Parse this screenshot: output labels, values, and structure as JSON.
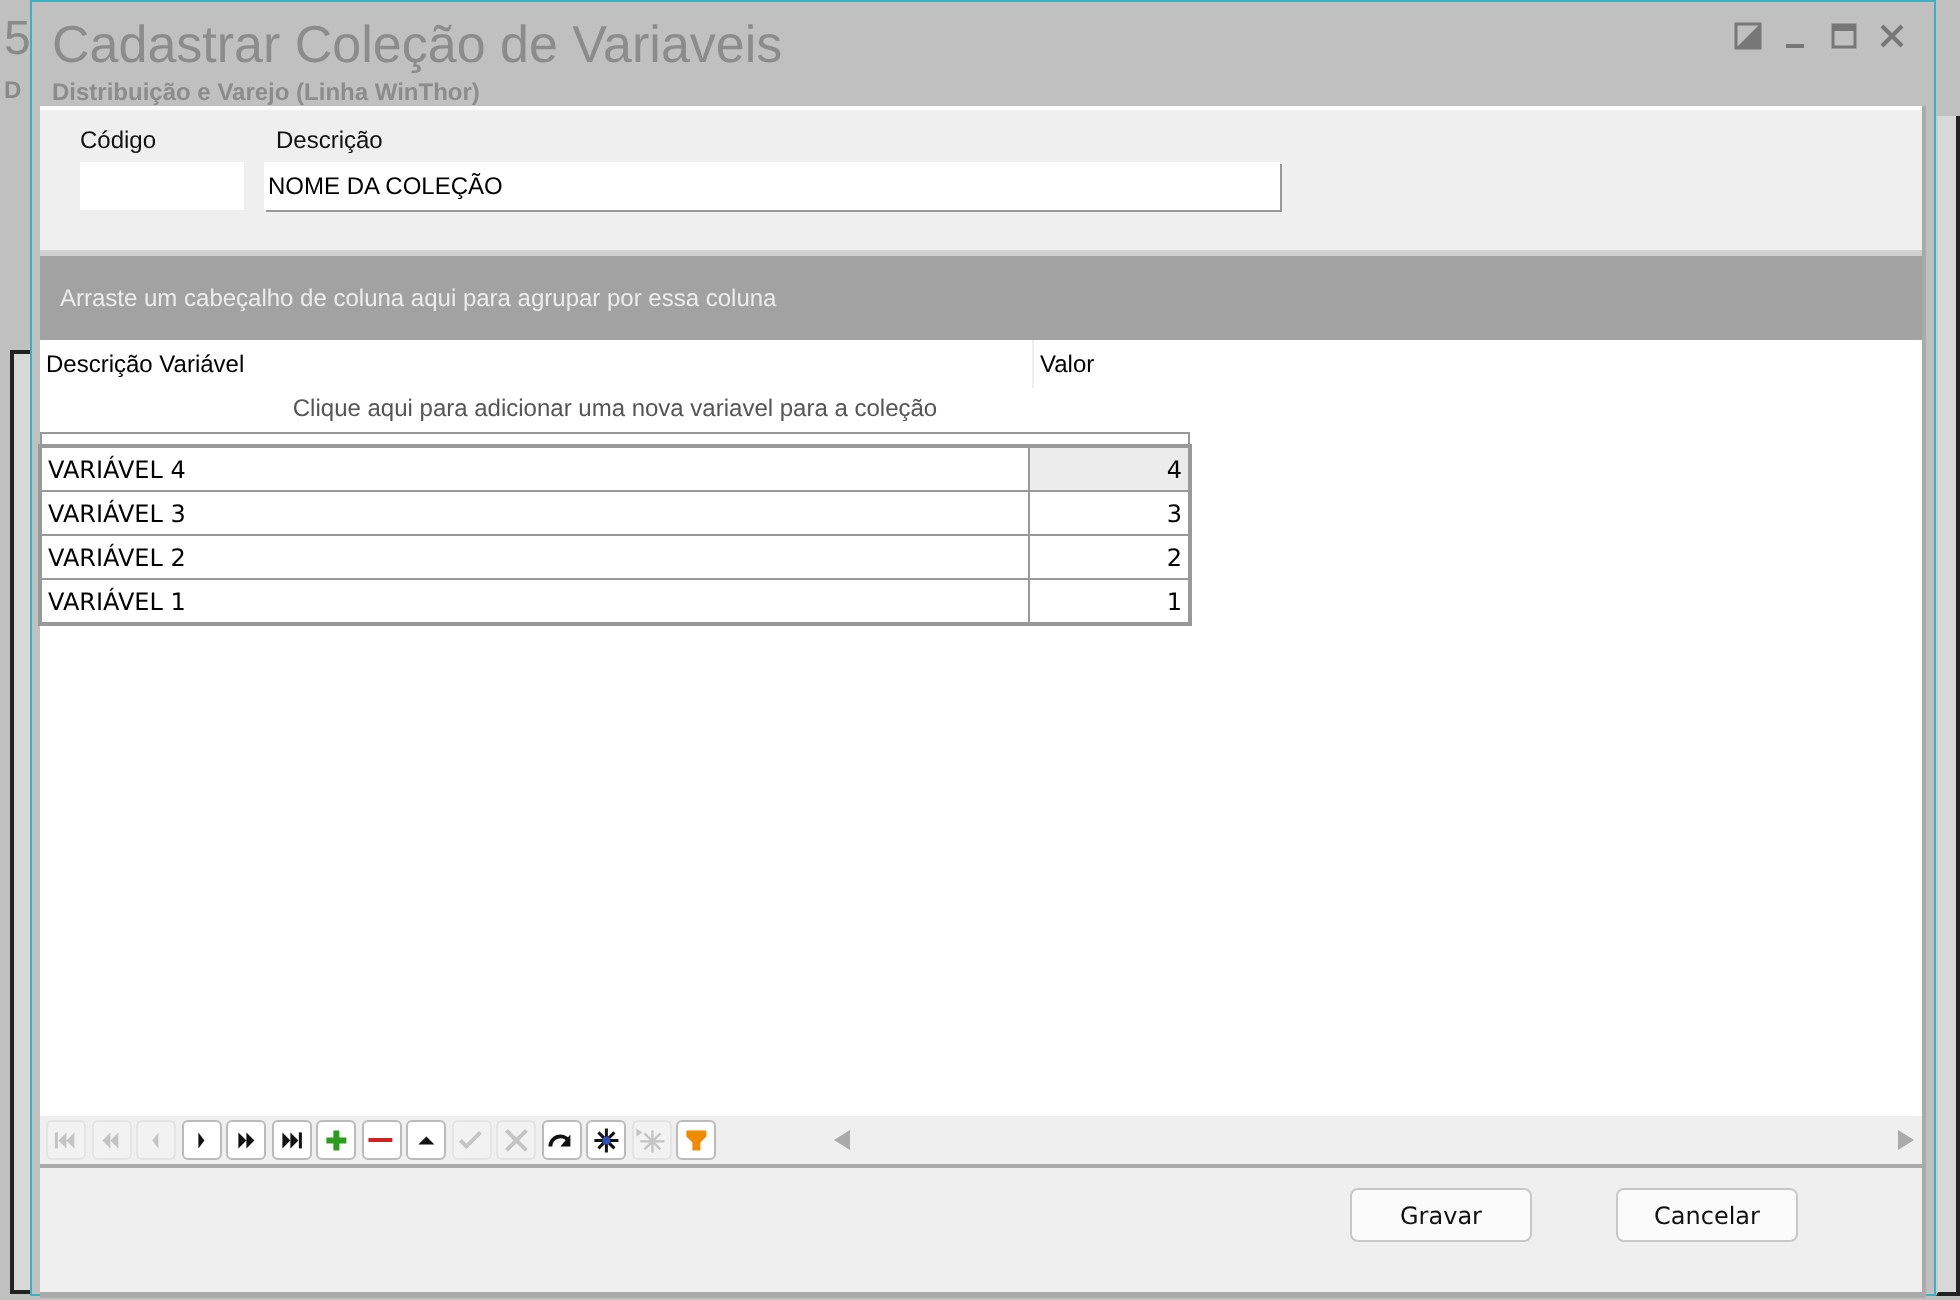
{
  "background_window": {
    "texts": [
      "5",
      "D"
    ]
  },
  "window": {
    "title": "Cadastrar Coleção de Variaveis",
    "subtitle": "Distribuição e Varejo (Linha WinThor)",
    "controls": [
      {
        "kind": "restore"
      },
      {
        "kind": "minimize"
      },
      {
        "kind": "maximize"
      },
      {
        "kind": "close"
      }
    ]
  },
  "form": {
    "fields": [
      {
        "label": "Código"
      },
      {
        "label": "Descrição",
        "value": "NOME DA COLEÇÃO"
      }
    ]
  },
  "grid": {
    "group_panel": "Arraste um cabeçalho de coluna aqui para agrupar por essa coluna",
    "columns": [
      "Descrição Variável",
      "Valor"
    ],
    "new_row_prompt": "Clique aqui para adicionar uma nova variavel para a coleção",
    "rows": [
      {
        "descricao": "VARIÁVEL 4",
        "valor": "4",
        "selected": true
      },
      {
        "descricao": "VARIÁVEL 3",
        "valor": "3",
        "selected": false
      },
      {
        "descricao": "VARIÁVEL 2",
        "valor": "2",
        "selected": false
      },
      {
        "descricao": "VARIÁVEL 1",
        "valor": "1",
        "selected": false
      }
    ]
  },
  "navigator": [
    {
      "kind": "first",
      "disabled": true
    },
    {
      "kind": "prev-page",
      "disabled": true
    },
    {
      "kind": "prev",
      "disabled": true
    },
    {
      "kind": "next",
      "disabled": false
    },
    {
      "kind": "next-page",
      "disabled": false
    },
    {
      "kind": "last",
      "disabled": false
    },
    {
      "kind": "insert",
      "disabled": false
    },
    {
      "kind": "delete",
      "disabled": false
    },
    {
      "kind": "edit",
      "disabled": false
    },
    {
      "kind": "post",
      "disabled": true
    },
    {
      "kind": "cancel",
      "disabled": true
    },
    {
      "kind": "refresh",
      "disabled": false
    },
    {
      "kind": "bookmark",
      "disabled": false
    },
    {
      "kind": "goto-bookmark",
      "disabled": true
    },
    {
      "kind": "filter",
      "disabled": false
    }
  ],
  "buttons": [
    "Gravar",
    "Cancelar"
  ]
}
